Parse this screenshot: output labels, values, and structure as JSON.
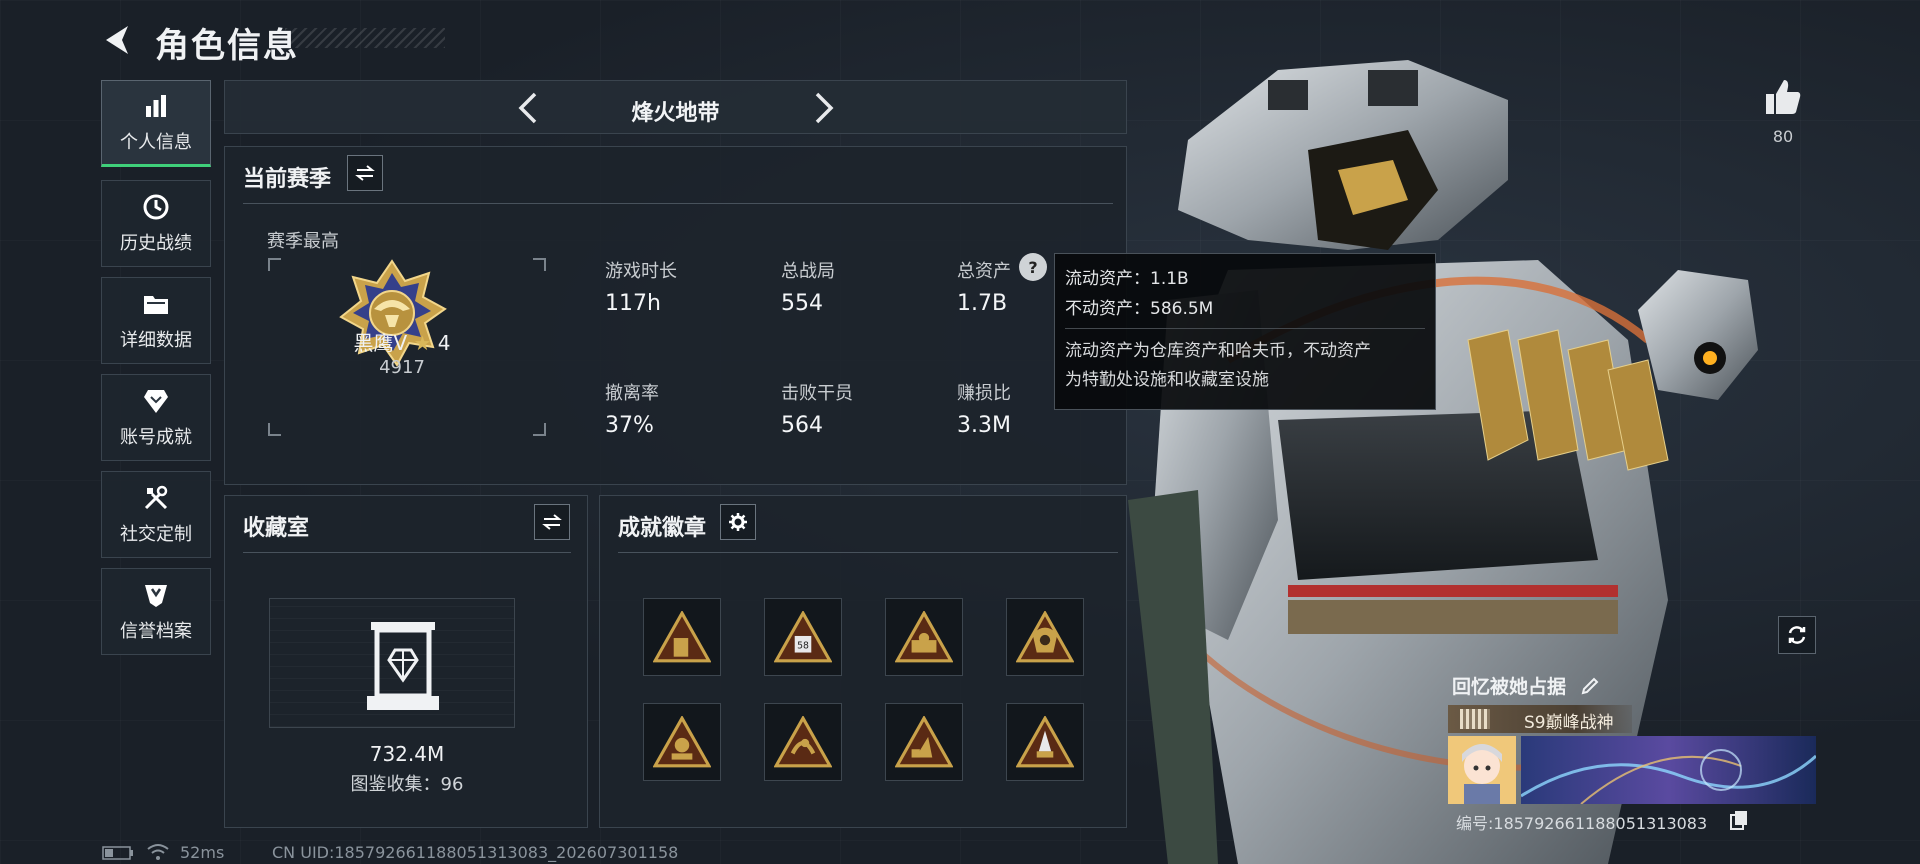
{
  "header": {
    "title": "角色信息"
  },
  "sidebar": {
    "items": [
      {
        "label": "个人信息",
        "icon": "bar-chart-icon",
        "active": true
      },
      {
        "label": "历史战绩",
        "icon": "history-clock-icon",
        "active": false
      },
      {
        "label": "详细数据",
        "icon": "folder-icon",
        "active": false
      },
      {
        "label": "账号成就",
        "icon": "achievement-icon",
        "active": false
      },
      {
        "label": "社交定制",
        "icon": "tools-icon",
        "active": false
      },
      {
        "label": "信誉档案",
        "icon": "shield-icon",
        "active": false
      }
    ]
  },
  "mode": {
    "name": "烽火地带"
  },
  "season": {
    "title": "当前赛季",
    "best_label": "赛季最高",
    "rank_name": "黑鹰Ⅴ",
    "rank_stars": "4",
    "rank_score": "4917",
    "stats": [
      {
        "label": "游戏时长",
        "value": "117h"
      },
      {
        "label": "总战局",
        "value": "554"
      },
      {
        "label": "总资产",
        "value": "1.7B"
      },
      {
        "label": "撤离率",
        "value": "37%"
      },
      {
        "label": "击败干员",
        "value": "564"
      },
      {
        "label": "赚损比",
        "value": "3.3M"
      }
    ]
  },
  "tooltip": {
    "liquid": "流动资产：1.1B",
    "fixed": "不动资产：586.5M",
    "desc_line1": "流动资产为仓库资产和哈夫币，不动资产",
    "desc_line2": "为特勤处设施和收藏室设施"
  },
  "collection": {
    "title": "收藏室",
    "value": "732.4M",
    "catalog": "图鉴收集：96"
  },
  "badges": {
    "title": "成就徽章",
    "items": [
      {
        "icon": "badge-icon-1"
      },
      {
        "icon": "badge-icon-2",
        "text": "58"
      },
      {
        "icon": "badge-icon-3"
      },
      {
        "icon": "badge-icon-4"
      },
      {
        "icon": "badge-icon-5"
      },
      {
        "icon": "badge-icon-6"
      },
      {
        "icon": "badge-icon-7"
      },
      {
        "icon": "badge-icon-8"
      }
    ]
  },
  "likes": {
    "count": "80"
  },
  "profile": {
    "card_title": "回忆被她占据",
    "season_title": "S9巅峰战神",
    "id_text": "编号:1857926611880513130​83"
  },
  "status": {
    "ping": "52ms",
    "uid": "CN UID:1857926611880513130​83_202607301158"
  },
  "colors": {
    "accent_green": "#3fd07a",
    "gold": "#c9a24a"
  }
}
